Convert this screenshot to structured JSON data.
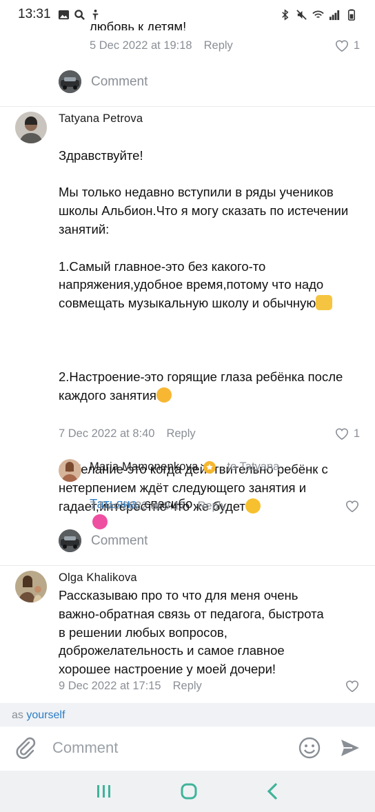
{
  "status": {
    "time": "13:31"
  },
  "comments": [
    {
      "partial_text": "любовь к детям!",
      "date": "5 Dec 2022 at 19:18",
      "reply_label": "Reply",
      "likes": "1"
    },
    {
      "comment_label": "Comment"
    },
    {
      "author": "Tatyana Petrova",
      "text": "Здравствуйте!\n\nМы только недавно вступили в ряды учеников школы Альбион.Что я могу сказать по истечении занятий:\n\n1.Самый главное-это без какого-то напряжения,удобное время,потому что надо совмещать музыкальную школу и обычную",
      "text2": "2.Настроение-это горящие глаза ребёнка после каждого занятия",
      "text3": "3.Желание-это когда действительно ребёнк с нетерпением ждёт следующего занятия и гадает,интерестно что же будет",
      "date": "7 Dec 2022 at 8:40",
      "reply_label": "Reply",
      "likes": "1"
    },
    {
      "author": "Maria Mamonenkova",
      "to_label": "to Tatyana",
      "mention": "Татьяна",
      "text": ", спасибо",
      "date": "7 Dec 2022 at 9:17",
      "reply_label": "Reply"
    },
    {
      "comment_label": "Comment"
    },
    {
      "author": "Olga Khalikova",
      "text": "Рассказываю про то что для меня очень важно-обратная связь от педагога, быстрота в решении любых вопросов, доброжелательность и самое главное хорошее настроение у моей дочери!",
      "date": "9 Dec 2022 at 17:15",
      "reply_label": "Reply"
    }
  ],
  "composer": {
    "as_prefix": "as",
    "as_who": "yourself",
    "placeholder": "Comment"
  },
  "colors": {
    "link": "#2a7cc5",
    "muted": "#8a8f96",
    "nav_accent": "#3fb39a"
  },
  "icons": [
    "image-icon",
    "search-icon",
    "accessibility-icon",
    "bluetooth-icon",
    "mute-icon",
    "wifi-icon",
    "signal-icon",
    "battery-icon",
    "heart-icon",
    "attach-icon",
    "emoji-icon",
    "send-icon",
    "recent-apps-icon",
    "home-icon",
    "back-icon"
  ]
}
